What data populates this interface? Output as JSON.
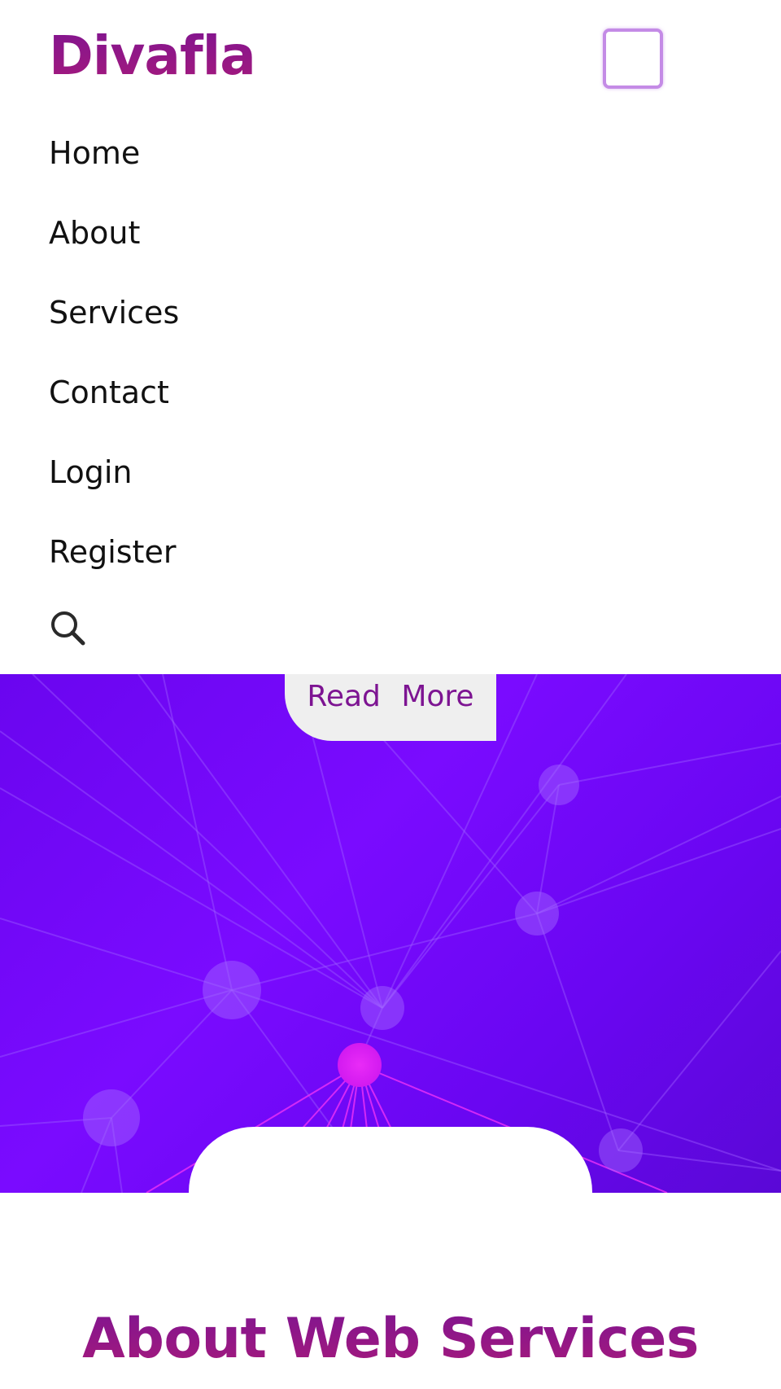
{
  "header": {
    "brand": "Divafla",
    "menu_toggle_icon": "menu-toggle-icon"
  },
  "nav": {
    "items": [
      {
        "label": "Home"
      },
      {
        "label": "About"
      },
      {
        "label": "Services"
      },
      {
        "label": "Contact"
      },
      {
        "label": "Login"
      },
      {
        "label": "Register"
      }
    ],
    "search_icon": "search-icon"
  },
  "hero": {
    "read_more_label": "Read More",
    "background_icon": "network-graph-background"
  },
  "about": {
    "title": "About Web Services"
  },
  "colors": {
    "brand": "#7d1492",
    "brand_gradient_end": "#a81a7a",
    "hero_background": "#7a0bff",
    "menu_toggle_border": "#c48be6",
    "read_more_background": "#efefef",
    "network_node_highlight": "#e01ef5"
  }
}
